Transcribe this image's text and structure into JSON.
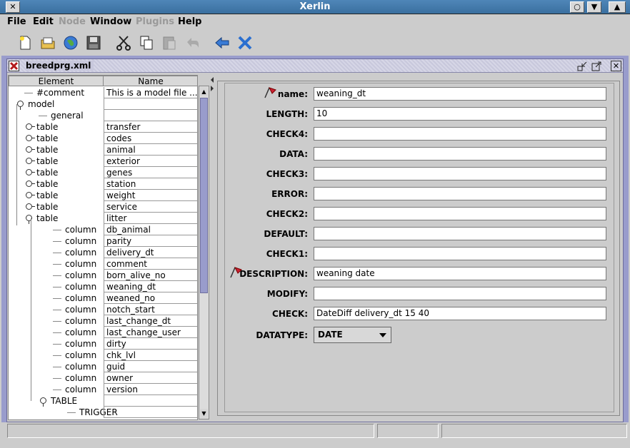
{
  "window": {
    "title": "Xerlin"
  },
  "menu": [
    "File",
    "Edit",
    "Node",
    "Window",
    "Plugins",
    "Help"
  ],
  "menu_disabled": [
    "Node",
    "Plugins"
  ],
  "toolbar_icons": [
    "new-file-icon",
    "open-folder-icon",
    "web-icon",
    "save-icon",
    "cut-icon",
    "copy-icon",
    "paste-icon",
    "undo-icon",
    "back-arrow-icon",
    "delete-x-icon"
  ],
  "document": {
    "title": "breedprg.xml"
  },
  "tree": {
    "headers": {
      "element": "Element",
      "name": "Name"
    },
    "rows": [
      {
        "el": "#comment",
        "nm": "This is a model file ..."
      },
      {
        "el": "model",
        "nm": ""
      },
      {
        "el": "general",
        "nm": ""
      },
      {
        "el": "table",
        "nm": "transfer"
      },
      {
        "el": "table",
        "nm": "codes"
      },
      {
        "el": "table",
        "nm": "animal"
      },
      {
        "el": "table",
        "nm": "exterior"
      },
      {
        "el": "table",
        "nm": "genes"
      },
      {
        "el": "table",
        "nm": "station"
      },
      {
        "el": "table",
        "nm": "weight"
      },
      {
        "el": "table",
        "nm": "service"
      },
      {
        "el": "table",
        "nm": "litter"
      },
      {
        "el": "column",
        "nm": "db_animal"
      },
      {
        "el": "column",
        "nm": "parity"
      },
      {
        "el": "column",
        "nm": "delivery_dt"
      },
      {
        "el": "column",
        "nm": "comment"
      },
      {
        "el": "column",
        "nm": "born_alive_no"
      },
      {
        "el": "column",
        "nm": "weaning_dt"
      },
      {
        "el": "column",
        "nm": "weaned_no"
      },
      {
        "el": "column",
        "nm": "notch_start"
      },
      {
        "el": "column",
        "nm": "last_change_dt"
      },
      {
        "el": "column",
        "nm": "last_change_user"
      },
      {
        "el": "column",
        "nm": "dirty"
      },
      {
        "el": "column",
        "nm": "chk_lvl"
      },
      {
        "el": "column",
        "nm": "guid"
      },
      {
        "el": "column",
        "nm": "owner"
      },
      {
        "el": "column",
        "nm": "version"
      },
      {
        "el": "TABLE",
        "nm": ""
      },
      {
        "el": "TRIGGER",
        "nm": ""
      }
    ]
  },
  "form": {
    "fields": [
      {
        "label": "name:",
        "value": "weaning_dt"
      },
      {
        "label": "LENGTH:",
        "value": "10"
      },
      {
        "label": "CHECK4:",
        "value": ""
      },
      {
        "label": "DATA:",
        "value": ""
      },
      {
        "label": "CHECK3:",
        "value": ""
      },
      {
        "label": "ERROR:",
        "value": ""
      },
      {
        "label": "CHECK2:",
        "value": ""
      },
      {
        "label": "DEFAULT:",
        "value": ""
      },
      {
        "label": "CHECK1:",
        "value": ""
      },
      {
        "label": "DESCRIPTION:",
        "value": "weaning date"
      },
      {
        "label": "MODIFY:",
        "value": ""
      },
      {
        "label": "CHECK:",
        "value": "DateDiff delivery_dt 15 40"
      }
    ],
    "datatype": {
      "label": "DATATYPE:",
      "value": "DATE"
    }
  },
  "colors": {
    "titlebar": "#3a6f9f",
    "desktop": "#999ccc",
    "scroll_thumb": "#999ccc",
    "flag": "#cc2233"
  }
}
